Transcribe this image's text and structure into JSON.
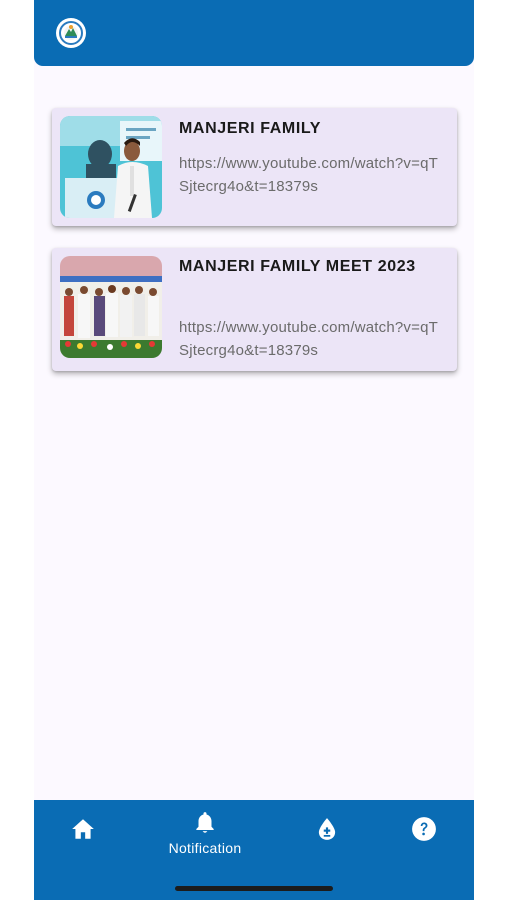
{
  "header": {
    "logo_icon": "organization-logo"
  },
  "videos": [
    {
      "title": "MANJERI FAMILY",
      "link": "https://www.youtube.com/watch?v=qTSjtecrg4o&t=18379s",
      "thumbnail": "speaker-at-podium-photo"
    },
    {
      "title": "MANJERI FAMILY MEET 2023",
      "link": "https://www.youtube.com/watch?v=qTSjtecrg4o&t=18379s",
      "thumbnail": "group-on-stage-photo"
    }
  ],
  "bottom_nav": {
    "items": [
      {
        "icon": "home-icon",
        "label": ""
      },
      {
        "icon": "bell-icon",
        "label": "Notification"
      },
      {
        "icon": "blood-drop-icon",
        "label": ""
      },
      {
        "icon": "help-icon",
        "label": ""
      }
    ]
  },
  "colors": {
    "primary": "#0a6cb4",
    "card_background": "#ece5f7",
    "page_background": "#fcf9ff"
  }
}
